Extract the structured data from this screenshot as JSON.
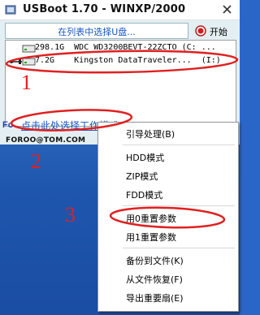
{
  "window": {
    "title": "USBoot 1.70 - WINXP/2000",
    "prompt": "在列表中选择U盘...",
    "start_label": "开始",
    "mode_link": "点击此处选择工作模式",
    "email": "FOROO@TOM.COM",
    "logo_text": "Fo"
  },
  "drives": [
    {
      "text": "298.1G  WDC WD3200BEVT-22ZCTO (C: ..."
    },
    {
      "text": "7.2G    Kingston DataTraveler...  (I:)"
    }
  ],
  "menu": {
    "items": [
      {
        "label": "引导处理(B)"
      },
      {
        "label": "HDD模式"
      },
      {
        "label": "ZIP模式"
      },
      {
        "label": "FDD模式"
      },
      {
        "label": "用0重置参数"
      },
      {
        "label": "用1重置参数"
      },
      {
        "label": "备份到文件(K)"
      },
      {
        "label": "从文件恢复(F)"
      },
      {
        "label": "导出重要扇(E)"
      }
    ]
  },
  "annotations": {
    "step1": "1",
    "step2": "2",
    "step3": "3",
    "color": "#e02020"
  },
  "colors": {
    "link": "#1655c4",
    "panel": "#e3eff2",
    "desktop": "#2e6cc4"
  }
}
